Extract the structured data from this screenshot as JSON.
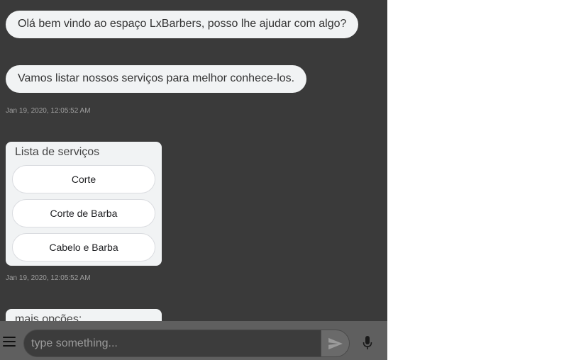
{
  "messages": {
    "greeting": "Olá bem vindo ao espaço LxBarbers, posso lhe ajudar com algo?",
    "intro": "Vamos listar nossos serviços para melhor conhece-los.",
    "timestamp_1": "Jan 19, 2020, 12:05:52 AM",
    "timestamp_2": "Jan 19, 2020, 12:05:52 AM"
  },
  "services_card": {
    "title": "Lista de serviços",
    "options": [
      "Corte",
      "Corte de Barba",
      "Cabelo e Barba"
    ]
  },
  "more_card": {
    "title": "mais opções:"
  },
  "input_bar": {
    "placeholder": "type something...",
    "icons": {
      "menu": "menu-icon",
      "send": "send-icon",
      "mic": "microphone-icon"
    }
  },
  "colors": {
    "chat_background": "#3a3a3a",
    "bubble_background": "#f1f3f4",
    "input_bar_background": "#5f5f5f"
  }
}
